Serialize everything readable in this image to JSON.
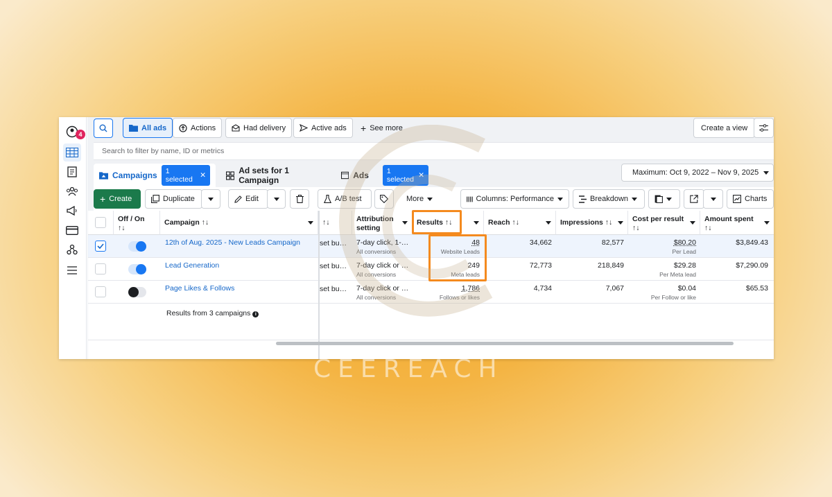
{
  "nav": {
    "notification_count": "4"
  },
  "topbar": {
    "filters": [
      "All ads",
      "Actions",
      "Had delivery",
      "Active ads"
    ],
    "see_more": "See more",
    "create_view": "Create a view"
  },
  "search": {
    "placeholder": "Search to filter by name, ID or metrics"
  },
  "tabs": {
    "campaigns": "Campaigns",
    "campaigns_selected": "1 selected",
    "adsets": "Ad sets for 1 Campaign",
    "ads": "Ads",
    "ads_selected": "1 selected"
  },
  "date_range": "Maximum: Oct 9, 2022 – Nov 9, 2025",
  "toolbar": {
    "create": "Create",
    "duplicate": "Duplicate",
    "edit": "Edit",
    "ab_test": "A/B test",
    "more": "More",
    "columns": "Columns: Performance",
    "breakdown": "Breakdown",
    "charts": "Charts"
  },
  "table": {
    "headers": {
      "off_on": "Off / On",
      "campaign": "Campaign ↑↓",
      "attribution": "Attribution setting",
      "results": "Results ↑↓",
      "reach": "Reach ↑↓",
      "impressions": "Impressions ↑↓",
      "cost_per_result": "Cost per result",
      "amount_spent": "Amount spent",
      "sort_icon": "↑↓"
    },
    "rows": [
      {
        "campaign": "12th of Aug. 2025 - New Leads Campaign",
        "bid": "set bu…",
        "attribution": "7-day click, 1-…",
        "attribution_sub": "All conversions",
        "results": "48",
        "results_sub": "Website Leads",
        "reach": "34,662",
        "impressions": "82,577",
        "cpr": "$80.20",
        "cpr_sub": "Per Lead",
        "spent": "$3,849.43"
      },
      {
        "campaign": "Lead Generation",
        "bid": "set bu…",
        "attribution": "7-day click or …",
        "attribution_sub": "All conversions",
        "results": "249",
        "results_sub": "Meta leads",
        "reach": "72,773",
        "impressions": "218,849",
        "cpr": "$29.28",
        "cpr_sub": "Per Meta lead",
        "spent": "$7,290.09"
      },
      {
        "campaign": "Page Likes & Follows",
        "bid": "set bu…",
        "attribution": "7-day click or …",
        "attribution_sub": "All conversions",
        "results": "1,786",
        "results_sub": "Follows or likes",
        "reach": "4,734",
        "impressions": "7,067",
        "cpr": "$0.04",
        "cpr_sub": "Per Follow or like",
        "spent": "$65.53"
      }
    ],
    "footer": "Results from 3 campaigns"
  },
  "watermark": "CEEREACH",
  "colors": {
    "accent": "#1877f2",
    "highlight": "#f48a1e",
    "create_green": "#1b7a4b"
  }
}
